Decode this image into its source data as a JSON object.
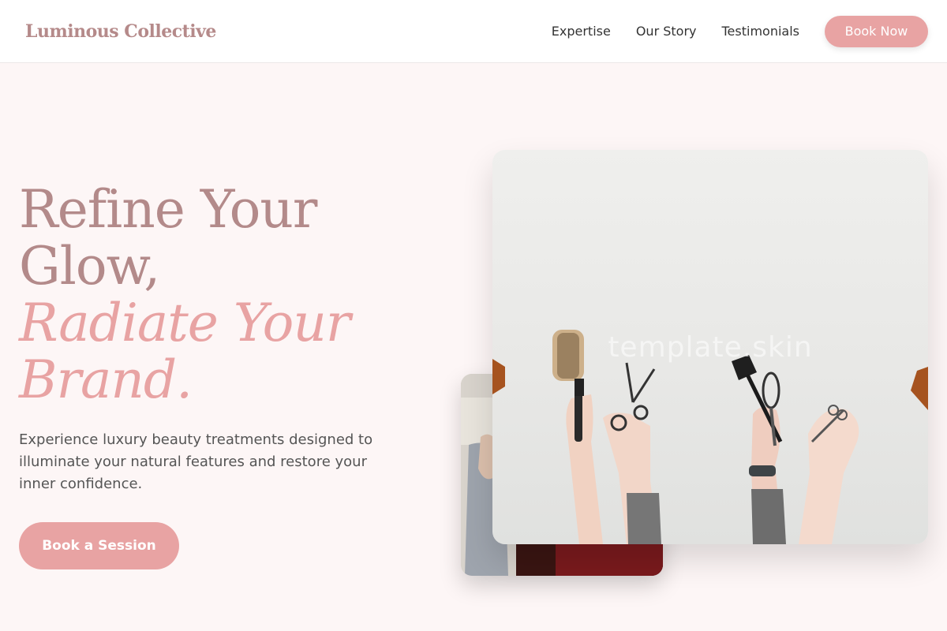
{
  "header": {
    "brand": "Luminous Collective",
    "nav": [
      {
        "label": "Expertise"
      },
      {
        "label": "Our Story"
      },
      {
        "label": "Testimonials"
      }
    ],
    "cta_label": "Book Now"
  },
  "hero": {
    "headline_line1": "Refine Your Glow,",
    "headline_accent": "Radiate Your Brand.",
    "description": "Experience luxury beauty treatments designed to illuminate your natural features and restore your inner confidence.",
    "cta_label": "Book a Session"
  },
  "images": {
    "main_watermark": "template.skin"
  },
  "colors": {
    "brand": "#b58a8a",
    "accent": "#e8a3a3",
    "background": "#fdf6f6",
    "text": "#555555"
  }
}
